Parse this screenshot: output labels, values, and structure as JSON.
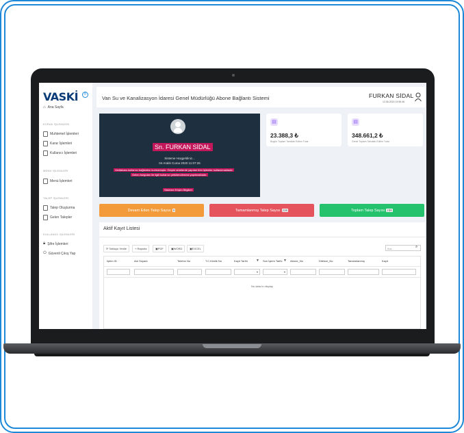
{
  "app": {
    "logo_text": "VASKİ",
    "logo_badge": "®",
    "title": "Van Su ve Kanalizasyon İdaresi Genel Müdürlüğü Abone Bağlantı Sistemi"
  },
  "user": {
    "name": "FURKAN SİDAL",
    "timestamp": "12.06.2020 13:59:46"
  },
  "sidebar": {
    "home": "Ana Sayfa",
    "sections": [
      {
        "title": "EVRAK İŞLEMLERİ",
        "items": [
          "Muhtemel İşlemleri",
          "Karar İşlemleri",
          "Kullanıcı İşlemleri"
        ]
      },
      {
        "title": "MENÜ İŞLEMLERİ",
        "items": [
          "Menü İşlemleri"
        ]
      },
      {
        "title": "TALEP İŞLEMLERİ",
        "items": [
          "Talep Oluşturma",
          "Gelen Talepler"
        ]
      },
      {
        "title": "KULLANICI İŞLEMLERİ",
        "items": [
          "Şifre İşlemleri",
          "Güvenli Çıkış Yap"
        ]
      }
    ]
  },
  "welcome": {
    "name_banner": "Sn. FURKAN SİDAL",
    "greeting": "Sisteme Hoşgeldiniz...",
    "date_line": "04 Aralık Cuma 2020 11:07:26",
    "warning_line1": "Veritabanı kullanıcı bağlantısı kurmamıştır. Geçen sürelerde yapılan tüm işlemler kullanılmaktadır",
    "warning_line2": "Gelen bulguları ile ilgili kullanıcı yetkilendirmesi yapılmaktadır.",
    "link": "Sisteme Erişim Bilgileri"
  },
  "stats": [
    {
      "icon": "chart-icon",
      "amount": "23.388,3 ₺",
      "label": "Bugün Toplam Tahsilatı Edilen Tutar"
    },
    {
      "icon": "chart-icon",
      "amount": "348.661,2 ₺",
      "label": "Genel Toplam Tahsilatı Edilen Tutar"
    }
  ],
  "talep_buttons": [
    {
      "label": "Devam Eden Talep Sayısı",
      "count": "0",
      "color": "#f39a3a"
    },
    {
      "label": "Tamamlanmış Talep Sayısı",
      "count": "238",
      "color": "#e5535c"
    },
    {
      "label": "Toplam Talep Sayısı",
      "count": "238",
      "color": "#25c26e"
    }
  ],
  "active_list": {
    "title": "Aktif Kayıt Listesi",
    "toolbar": [
      "Tabloyu Yenile",
      "Raporla",
      "PDF",
      "WORD",
      "EXCEL"
    ],
    "search_placeholder": "Ara...",
    "columns": [
      "İşlem ID",
      "Adı Soyadı",
      "Telefon No",
      "T.C.Kimlik No",
      "Kayıt Tarihi",
      "Son İşlem Tarihi",
      "Abone_No",
      "Dilekce_No",
      "Tamamlanmış",
      "Kayıt"
    ],
    "empty_text": "No data to display"
  }
}
